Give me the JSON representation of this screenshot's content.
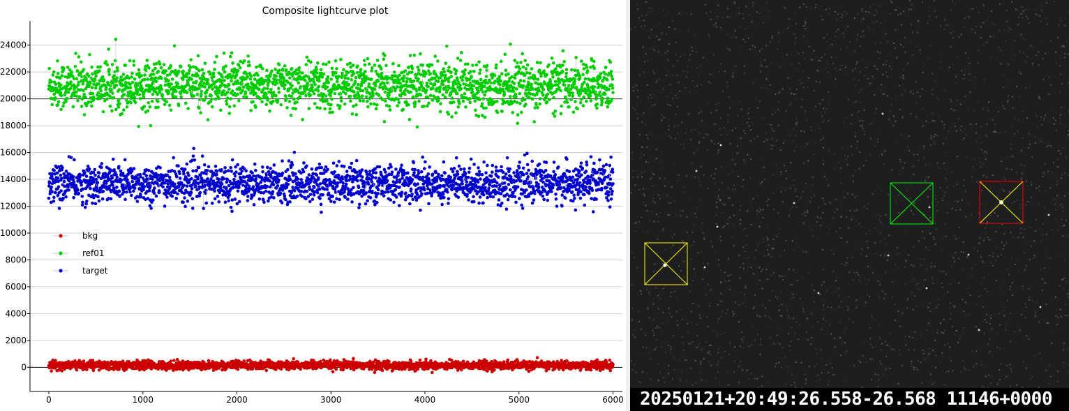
{
  "chart_data": {
    "type": "scatter",
    "title": "Composite lightcurve plot",
    "xlabel": "",
    "ylabel": "",
    "xlim": [
      -200,
      6100
    ],
    "ylim": [
      -1800,
      25800
    ],
    "x_ticks": [
      0,
      1000,
      2000,
      3000,
      4000,
      5000,
      6000
    ],
    "y_ticks": [
      0,
      2000,
      4000,
      6000,
      8000,
      10000,
      12000,
      14000,
      16000,
      18000,
      20000,
      22000,
      24000
    ],
    "grid": "horizontal",
    "legend_position": "middle-left",
    "x_range": [
      0,
      6000
    ],
    "series": [
      {
        "name": "bkg",
        "color": "#cc0000",
        "mean": 150,
        "spread": 160,
        "min": -500,
        "max": 900
      },
      {
        "name": "ref01",
        "color": "#00cc00",
        "mean": 21000,
        "spread": 900,
        "min": 17900,
        "max": 24500
      },
      {
        "name": "target",
        "color": "#0000cc",
        "mean": 13700,
        "spread": 700,
        "min": 11100,
        "max": 16300
      }
    ]
  },
  "sky_image": {
    "background": "#1e1e1e",
    "markers": [
      {
        "name": "target",
        "color": "#ffff00",
        "fill_color": "#ff0000"
      },
      {
        "name": "reference",
        "color": "#00ff00"
      },
      {
        "name": "background",
        "color": "#ffff00"
      }
    ],
    "timestamp": "20250121+20:49:26.558-26.568 11146+0000"
  }
}
